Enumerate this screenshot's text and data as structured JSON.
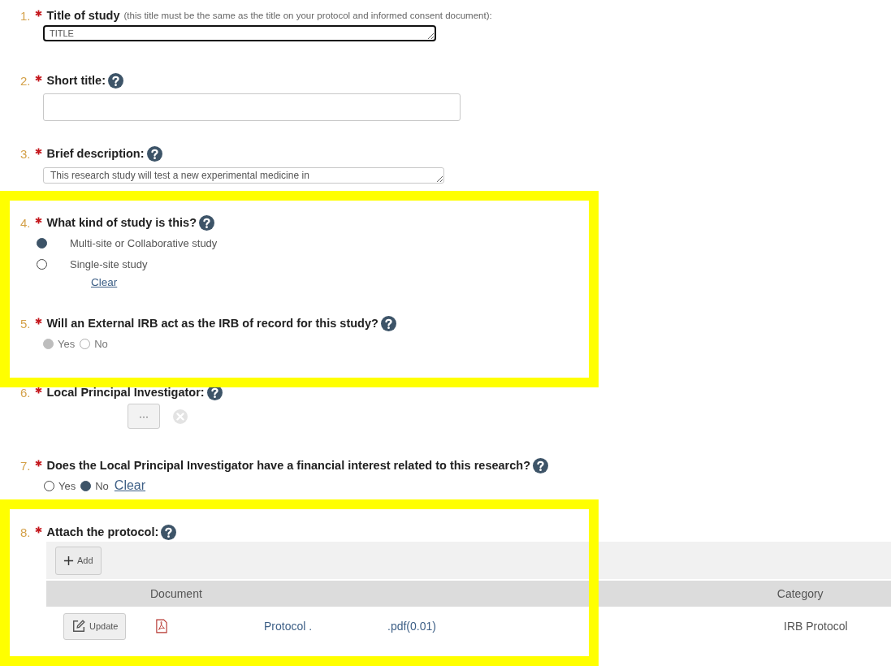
{
  "sections": [
    {
      "highlighted": false,
      "questions": [
        {
          "number": "1.",
          "required": true,
          "label": "Title of study",
          "note": "(this title must be the same as the title on your protocol and informed consent document):",
          "help": false,
          "kind": "textarea",
          "value": "TITLE",
          "focused": true
        },
        {
          "number": "2.",
          "required": true,
          "label": "Short title:",
          "help": true,
          "kind": "text",
          "focused": false
        },
        {
          "number": "3.",
          "required": true,
          "label": "Brief description:",
          "help": true,
          "kind": "textarea",
          "value": "This research study will test a new experimental medicine in",
          "focused": false
        }
      ]
    },
    {
      "highlighted": true,
      "questions": [
        {
          "number": "4.",
          "required": true,
          "label": "What kind of study is this?",
          "help": true,
          "kind": "radio_list",
          "clear": "Clear",
          "options": [
            {
              "label": "Multi-site or Collaborative study",
              "selected": true,
              "disabled": false
            },
            {
              "label": "Single-site study",
              "selected": false,
              "disabled": false
            }
          ]
        },
        {
          "number": "5.",
          "required": true,
          "label": "Will an External IRB act as the IRB of record for this study?",
          "help": true,
          "kind": "radio_inline",
          "options": [
            {
              "label": "Yes",
              "selected": true,
              "disabled": true
            },
            {
              "label": "No",
              "selected": false,
              "disabled": true
            }
          ]
        }
      ]
    },
    {
      "highlighted": false,
      "questions": [
        {
          "number": "6.",
          "required": true,
          "label": "Local Principal Investigator:",
          "help": true,
          "kind": "person",
          "button": "···"
        },
        {
          "number": "7.",
          "required": true,
          "label": "Does the Local Principal Investigator have a financial interest related to this research?",
          "help": true,
          "kind": "radio_inline",
          "clear": "Clear",
          "options": [
            {
              "label": "Yes",
              "selected": false,
              "disabled": false
            },
            {
              "label": "No",
              "selected": true,
              "disabled": false
            }
          ]
        }
      ]
    },
    {
      "highlighted": true,
      "questions": [
        {
          "number": "8.",
          "required": true,
          "label": "Attach the protocol:",
          "help": true,
          "kind": "attachments",
          "add_button": "Add",
          "columns": [
            "Document",
            "Category"
          ],
          "rows": [
            {
              "button": "Update",
              "document": "Protocol .",
              "file": ".pdf(0.01)",
              "category": "IRB Protocol"
            }
          ]
        }
      ]
    }
  ]
}
